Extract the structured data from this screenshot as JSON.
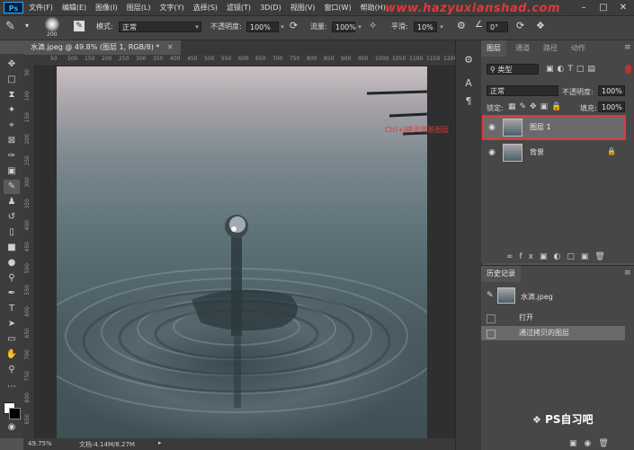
{
  "menubar": {
    "logo": "Ps",
    "items": [
      "文件(F)",
      "编辑(E)",
      "图像(I)",
      "图层(L)",
      "文字(Y)",
      "选择(S)",
      "滤镜(T)",
      "3D(D)",
      "视图(V)",
      "窗口(W)",
      "帮助(H)"
    ],
    "watermark": "www.hazyuxianshad.com"
  },
  "options": {
    "brush_size": "200",
    "mode_label": "模式:",
    "mode_value": "正常",
    "opacity_label": "不透明度:",
    "opacity_value": "100%",
    "flow_label": "流量:",
    "flow_value": "100%",
    "smooth_label": "平滑:",
    "smooth_value": "10%",
    "angle_value": "0°"
  },
  "document": {
    "tab_title": "水滴.jpeg @ 49.8% (图层 1, RGB/8) *",
    "ruler_ticks": [
      "50",
      "100",
      "150",
      "200",
      "250",
      "300",
      "350",
      "400",
      "450",
      "500",
      "550",
      "600",
      "650",
      "700",
      "750",
      "800",
      "850",
      "900",
      "950",
      "1000",
      "1050",
      "1100",
      "1150",
      "1200"
    ],
    "ruler_left_ticks": [
      "50",
      "100",
      "150",
      "200",
      "250",
      "300",
      "350",
      "400",
      "450",
      "500",
      "550",
      "600",
      "650",
      "700",
      "750",
      "800",
      "850"
    ]
  },
  "status": {
    "zoom": "49.75%",
    "doc_size": "文档:4.14M/8.27M"
  },
  "layers_panel": {
    "tabs": [
      "图层",
      "通道",
      "路径",
      "动作"
    ],
    "filter_kind": "类型",
    "blend_mode": "正常",
    "opacity_label": "不透明度:",
    "opacity_value": "100%",
    "lock_label": "锁定:",
    "fill_label": "填充:",
    "fill_value": "100%",
    "layers": [
      {
        "name": "图层 1",
        "selected": true
      },
      {
        "name": "背景",
        "locked": true
      }
    ],
    "annotation": "Ctrl+J拷贝背景图层"
  },
  "history_panel": {
    "title": "历史记录",
    "snapshot": "水滴.jpeg",
    "items": [
      "打开",
      "通过拷贝的图层"
    ]
  },
  "watermark_brand": "PS自习吧"
}
